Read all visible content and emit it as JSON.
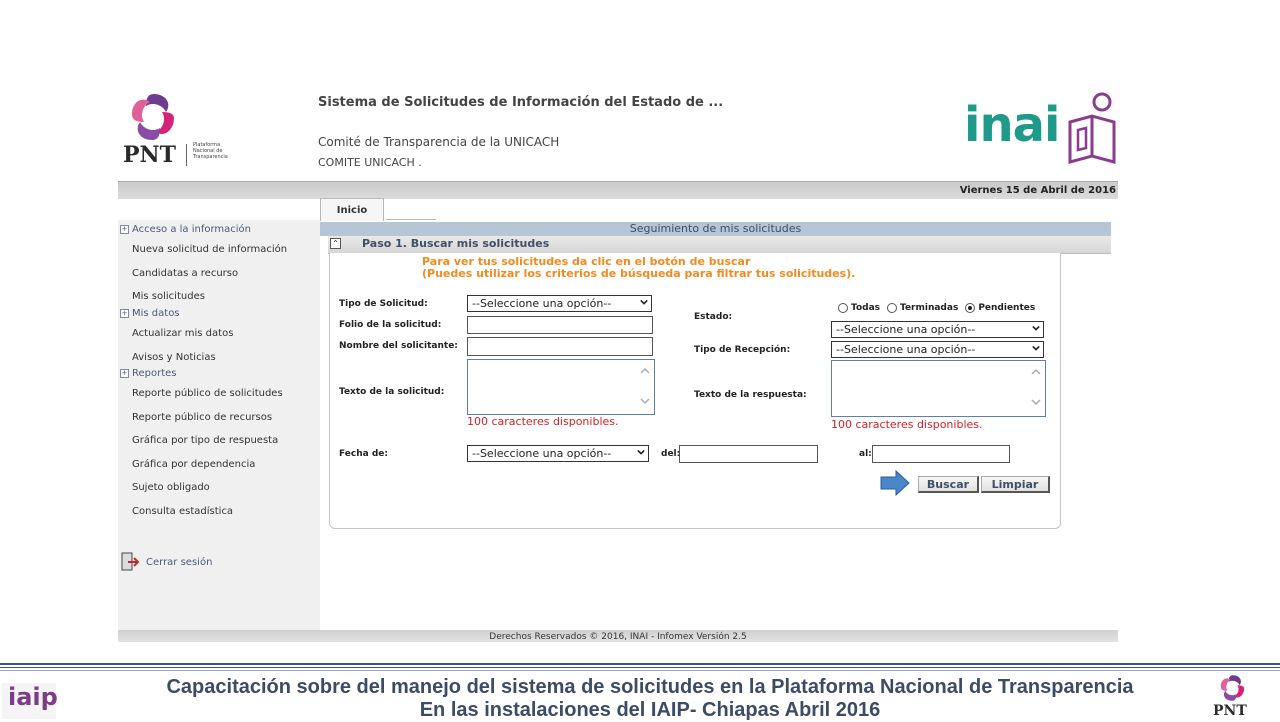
{
  "header": {
    "system_title": "Sistema de Solicitudes de Información del Estado de ...",
    "committee": "Comité de Transparencia de la UNICACH",
    "committee_short": "COMITE UNICACH .",
    "pnt_logo_text": "PNT",
    "pnt_logo_sub": "Plataforma Nacional de Transparencia",
    "inai_logo_text": "inai"
  },
  "date_bar": {
    "date": "Viernes 15 de Abril de 2016"
  },
  "tabs": {
    "home": "Inicio"
  },
  "sidebar": {
    "sections": [
      {
        "label": "Acceso a la información",
        "items": [
          "Nueva solicitud de información",
          "Candidatas a recurso",
          "Mis solicitudes"
        ]
      },
      {
        "label": "Mis datos",
        "items": [
          "Actualizar mis datos",
          "Avisos y Noticias"
        ]
      },
      {
        "label": "Reportes",
        "items": [
          "Reporte público de solicitudes",
          "Reporte público de recursos",
          "Gráfica por tipo de respuesta",
          "Gráfica por dependencia",
          "Sujeto obligado",
          "Consulta estadística"
        ]
      }
    ],
    "logout": "Cerrar sesión"
  },
  "main": {
    "panel_title": "Seguimiento de mis solicitudes",
    "step_title": "Paso 1. Buscar mis solicitudes",
    "hint_line1": "Para ver tus solicitudes da clic en el botón de buscar",
    "hint_line2": "(Puedes utilizar los criterios de búsqueda para filtrar tus solicitudes).",
    "fields": {
      "tipo_solicitud": {
        "label": "Tipo de Solicitud:",
        "value": "--Seleccione una opción--"
      },
      "folio": {
        "label": "Folio de la solicitud:",
        "value": ""
      },
      "nombre": {
        "label": "Nombre del solicitante:",
        "value": ""
      },
      "texto_solicitud": {
        "label": "Texto de la solicitud:",
        "chars": "100 caracteres disponibles."
      },
      "estado": {
        "label": "Estado:",
        "value": "--Seleccione una opción--",
        "radios": [
          {
            "label": "Todas",
            "checked": false
          },
          {
            "label": "Terminadas",
            "checked": false
          },
          {
            "label": "Pendientes",
            "checked": true
          }
        ]
      },
      "tipo_recepcion": {
        "label": "Tipo de Recepción:",
        "value": "--Seleccione una opción--"
      },
      "texto_respuesta": {
        "label": "Texto de la respuesta:",
        "chars": "100 caracteres disponibles."
      },
      "fecha": {
        "label": "Fecha de:",
        "value": "--Seleccione una opción--",
        "del_label": "del:",
        "al_label": "al:"
      }
    },
    "buttons": {
      "search": "Buscar",
      "clear": "Limpiar"
    }
  },
  "footer": {
    "copyright": "Derechos Reservados © 2016, INAI - Infomex Versión 2.5"
  },
  "slide_footer": {
    "line1": "Capacitación sobre del manejo del sistema de solicitudes en la Plataforma Nacional de Transparencia",
    "line2": "En las instalaciones del IAIP- Chiapas    Abril 2016",
    "iaip_logo": "iaip",
    "pnt_logo": "PNT"
  },
  "colors": {
    "hint_orange": "#f28a1e",
    "chars_red": "#d2202a",
    "inai_teal": "#1d9a8a",
    "pnt_purple": "#7a3d86"
  }
}
